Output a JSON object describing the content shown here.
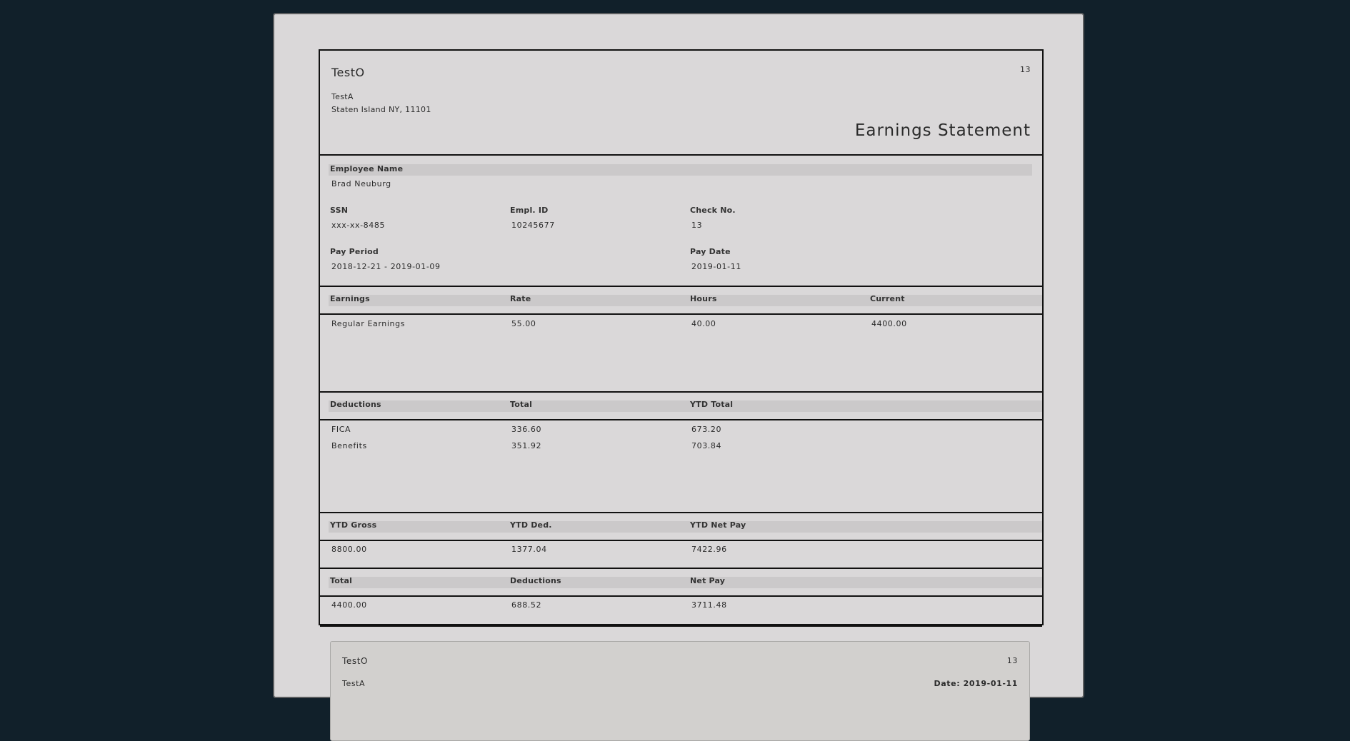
{
  "company": {
    "name": "TestO",
    "address_line1": "TestA",
    "address_line2": "Staten Island NY, 11101",
    "check_number": "13"
  },
  "title": "Earnings Statement",
  "employee": {
    "name_label": "Employee Name",
    "name": "Brad  Neuburg",
    "ssn_label": "SSN",
    "ssn": "xxx-xx-8485",
    "empl_id_label": "Empl. ID",
    "empl_id": "10245677",
    "check_no_label": "Check No.",
    "check_no": "13",
    "pay_period_label": "Pay Period",
    "pay_period": "2018-12-21 - 2019-01-09",
    "pay_date_label": "Pay Date",
    "pay_date": "2019-01-11"
  },
  "earnings": {
    "headers": [
      "Earnings",
      "Rate",
      "Hours",
      "Current"
    ],
    "rows": [
      [
        "Regular Earnings",
        "55.00",
        "40.00",
        "4400.00"
      ]
    ]
  },
  "deductions": {
    "headers": [
      "Deductions",
      "Total",
      "YTD Total"
    ],
    "rows": [
      [
        "FICA",
        "336.60",
        "673.20"
      ],
      [
        "Benefits",
        "351.92",
        "703.84"
      ]
    ]
  },
  "ytd": {
    "headers": [
      "YTD Gross",
      "YTD Ded.",
      "YTD Net Pay"
    ],
    "values": [
      "8800.00",
      "1377.04",
      "7422.96"
    ]
  },
  "totals": {
    "headers": [
      "Total",
      "Deductions",
      "Net Pay"
    ],
    "values": [
      "4400.00",
      "688.52",
      "3711.48"
    ]
  },
  "stub": {
    "company_name": "TestO",
    "check_number": "13",
    "partial_line_left": "TestA",
    "partial_line_right": "Date: 2019-01-11"
  }
}
